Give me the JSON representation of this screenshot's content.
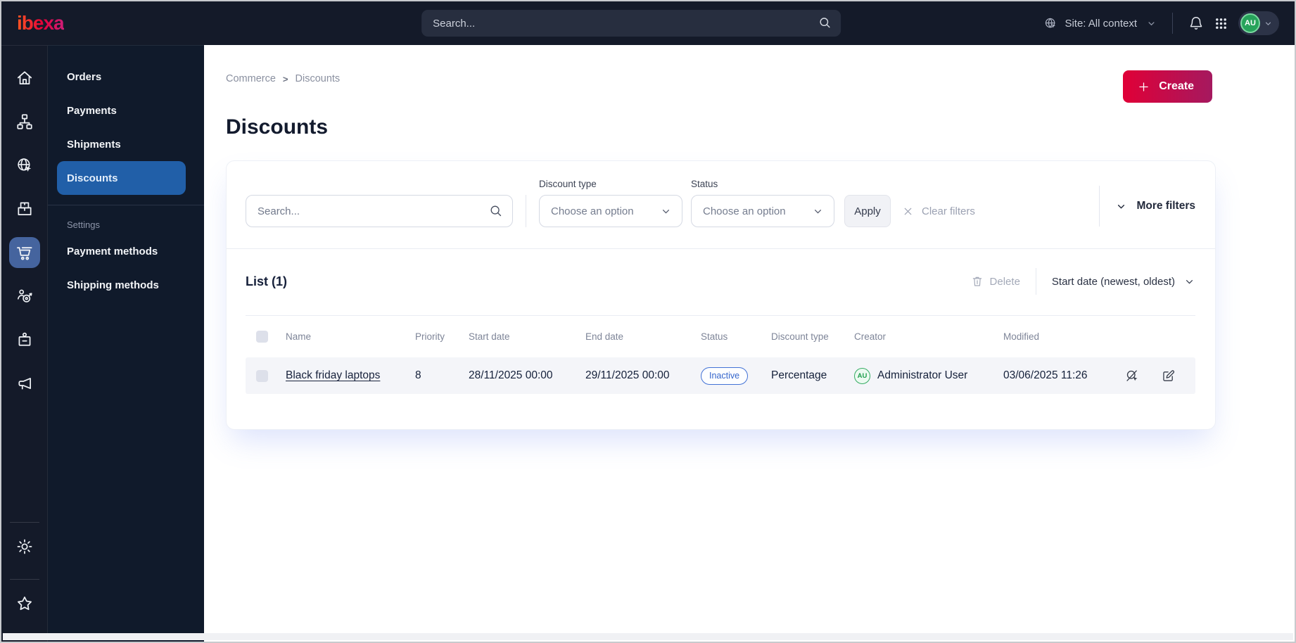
{
  "topbar": {
    "logo_text": "ibexa",
    "search_placeholder": "Search...",
    "site_context_label": "Site: All context",
    "avatar_initials": "AU"
  },
  "icon_rail": {
    "items": [
      "home-icon",
      "site-structure-icon",
      "website-globe-icon",
      "products-boxes-icon",
      "commerce-cart-icon",
      "customers-target-icon",
      "corporate-frame-icon",
      "marketing-megaphone-icon"
    ],
    "active_item": "commerce-cart-icon",
    "bottom_items": [
      "settings-gear-icon",
      "bookmarks-star-icon"
    ]
  },
  "sidebar": {
    "items": [
      {
        "label": "Orders",
        "active": false
      },
      {
        "label": "Payments",
        "active": false
      },
      {
        "label": "Shipments",
        "active": false
      },
      {
        "label": "Discounts",
        "active": true
      }
    ],
    "section_label": "Settings",
    "section_items": [
      {
        "label": "Payment methods"
      },
      {
        "label": "Shipping methods"
      }
    ]
  },
  "breadcrumb": {
    "items": [
      "Commerce",
      "Discounts"
    ],
    "separator": ">"
  },
  "page": {
    "title": "Discounts",
    "create_button_label": "Create"
  },
  "filters": {
    "search_placeholder": "Search...",
    "discount_type_label": "Discount type",
    "discount_type_value": "Choose an option",
    "status_label": "Status",
    "status_value": "Choose an option",
    "apply_label": "Apply",
    "clear_label": "Clear filters",
    "more_filters_label": "More filters"
  },
  "list": {
    "title": "List (1)",
    "delete_label": "Delete",
    "sort_label": "Start date (newest, oldest)",
    "columns": [
      "Name",
      "Priority",
      "Start date",
      "End date",
      "Status",
      "Discount type",
      "Creator",
      "Modified"
    ],
    "rows": [
      {
        "name": "Black friday laptops",
        "priority": "8",
        "start_date": "28/11/2025 00:00",
        "end_date": "29/11/2025 00:00",
        "status": "Inactive",
        "discount_type": "Percentage",
        "creator_initials": "AU",
        "creator": "Administrator User",
        "modified": "03/06/2025 11:26"
      }
    ]
  },
  "icons": [
    "search-icon",
    "globe-cursor-icon",
    "chevron-down-icon",
    "bell-icon",
    "apps-grid-icon",
    "plus-icon",
    "close-icon",
    "trash-icon",
    "deactivate-icon",
    "edit-icon",
    "home-icon",
    "site-structure-icon",
    "products-boxes-icon",
    "commerce-cart-icon",
    "customers-target-icon",
    "corporate-frame-icon",
    "marketing-megaphone-icon",
    "settings-gear-icon",
    "bookmarks-star-icon"
  ],
  "colors": {
    "topbar_bg": "#141a29",
    "menu_bg": "#101a2b",
    "active_menu_blue": "#215fa8",
    "active_rail_blue": "#45649e",
    "create_gradient_start": "#e00037",
    "create_gradient_end": "#a5195f",
    "status_blue": "#3566cc",
    "creator_green": "#28a558"
  }
}
